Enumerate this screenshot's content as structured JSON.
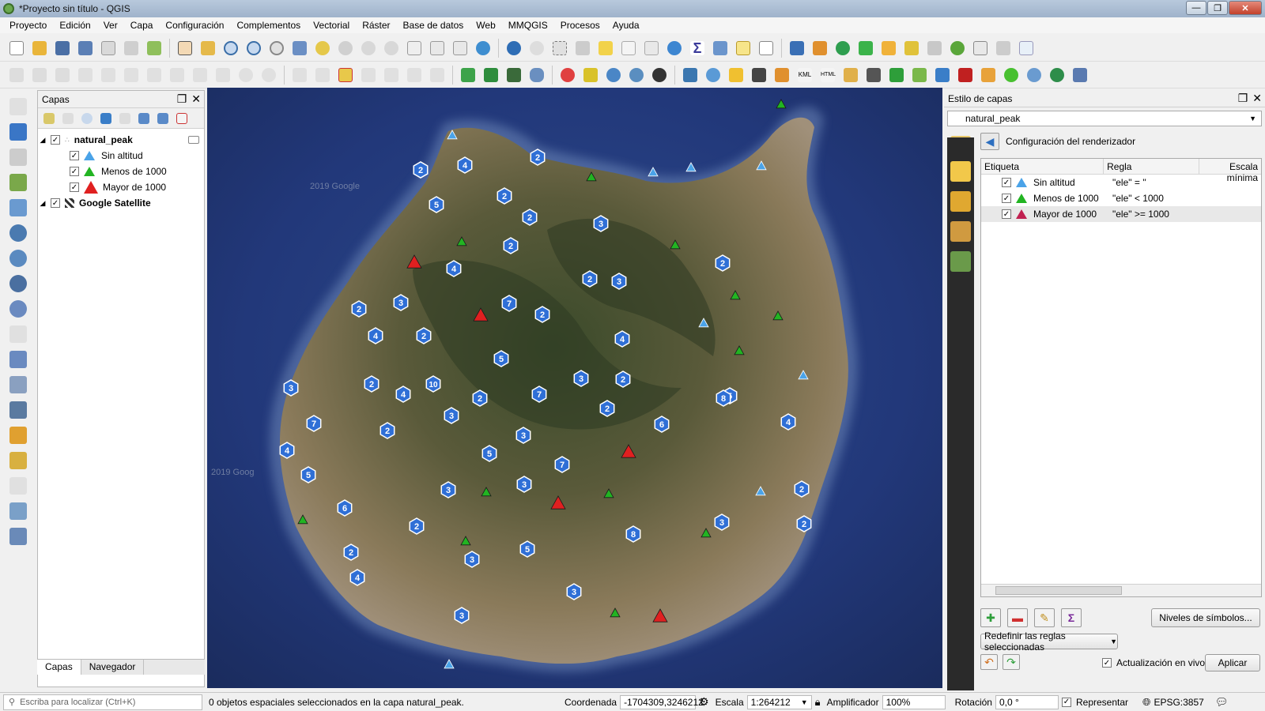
{
  "window": {
    "title": "*Proyecto sin título - QGIS"
  },
  "menu": [
    "Proyecto",
    "Edición",
    "Ver",
    "Capa",
    "Configuración",
    "Complementos",
    "Vectorial",
    "Ráster",
    "Base de datos",
    "Web",
    "MMQGIS",
    "Procesos",
    "Ayuda"
  ],
  "layers_panel": {
    "title": "Capas",
    "tree": [
      {
        "name": "natural_peak",
        "checked": true
      },
      {
        "name": "Sin altitud",
        "checked": true,
        "symbol": "blue-triangle"
      },
      {
        "name": "Menos de 1000",
        "checked": true,
        "symbol": "green-triangle"
      },
      {
        "name": "Mayor de 1000",
        "checked": true,
        "symbol": "red-triangle"
      },
      {
        "name": "Google Satellite",
        "checked": true
      }
    ],
    "tabs": [
      "Capas",
      "Navegador"
    ]
  },
  "style_panel": {
    "title": "Estilo de capas",
    "layer_combo": "natural_peak",
    "renderer_title": "Configuración del renderizador",
    "columns": [
      "Etiqueta",
      "Regla",
      "Escala mínima"
    ],
    "rules": [
      {
        "label": "Sin altitud",
        "rule": "\"ele\"  =  ''",
        "symbol": "blue-triangle"
      },
      {
        "label": "Menos de 1000",
        "rule": "\"ele\"  < 1000",
        "symbol": "green-triangle"
      },
      {
        "label": "Mayor de 1000",
        "rule": "\"ele\"  >= 1000",
        "symbol": "red-triangle"
      }
    ],
    "symbol_levels_btn": "Niveles de símbolos...",
    "refine_btn": "Redefinir las reglas seleccionadas",
    "live_update": "Actualización en vivo",
    "apply_btn": "Aplicar"
  },
  "map": {
    "watermark1": "2019 Google",
    "watermark2": "2019 Goog",
    "clusters": [
      "4",
      "2",
      "2",
      "5",
      "2",
      "3",
      "2",
      "4",
      "2",
      "3",
      "2",
      "3",
      "7",
      "2",
      "4",
      "2",
      "4",
      "5",
      "2",
      "10",
      "4",
      "2",
      "3",
      "2",
      "3",
      "7",
      "3",
      "5",
      "8",
      "4",
      "2",
      "7",
      "6",
      "2",
      "3",
      "4",
      "5",
      "7",
      "5",
      "3",
      "3",
      "6",
      "2",
      "3",
      "2",
      "2",
      "8",
      "5",
      "2",
      "3",
      "4",
      "3",
      "3",
      "2",
      "4",
      "2"
    ]
  },
  "statusbar": {
    "search_placeholder": "Escriba para localizar (Ctrl+K)",
    "message": "0 objetos espaciales seleccionados en la capa natural_peak.",
    "coord_label": "Coordenada",
    "coord_value": "-1704309,3246212",
    "scale_label": "Escala",
    "scale_value": "1:264212",
    "magnifier_label": "Amplificador",
    "magnifier_value": "100%",
    "rotation_label": "Rotación",
    "rotation_value": "0,0 °",
    "render_label": "Representar",
    "crs": "EPSG:3857"
  },
  "colors": {
    "blue": "#3a86d6",
    "green": "#22b422",
    "red": "#e02020",
    "cluster": "#2f6fd6"
  }
}
